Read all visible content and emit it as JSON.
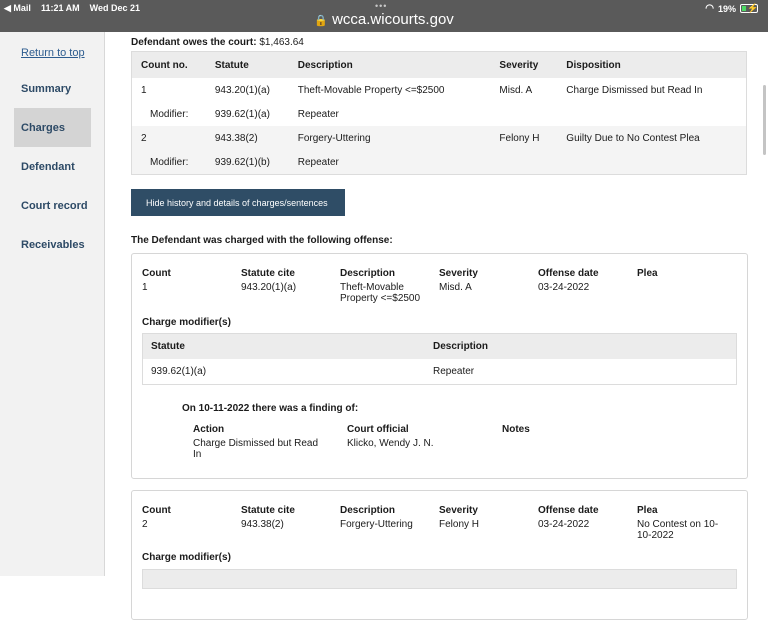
{
  "status_bar": {
    "back_app": "◀ Mail",
    "time": "11:21 AM",
    "date": "Wed Dec 21",
    "battery": "19%",
    "url": "wcca.wicourts.gov"
  },
  "sidebar": {
    "return_link": "Return to top",
    "items": [
      {
        "label": "Summary"
      },
      {
        "label": "Charges"
      },
      {
        "label": "Defendant"
      },
      {
        "label": "Court record"
      },
      {
        "label": "Receivables"
      }
    ]
  },
  "owes": {
    "label": "Defendant owes the court:",
    "amount": "$1,463.64"
  },
  "charges_table": {
    "headers": [
      "Count no.",
      "Statute",
      "Description",
      "Severity",
      "Disposition"
    ],
    "rows": [
      {
        "count": "1",
        "statute": "943.20(1)(a)",
        "description": "Theft-Movable Property <=$2500",
        "severity": "Misd. A",
        "disposition": "Charge Dismissed but Read In"
      },
      {
        "count": "Modifier:",
        "statute": "939.62(1)(a)",
        "description": "Repeater",
        "severity": "",
        "disposition": ""
      },
      {
        "count": "2",
        "statute": "943.38(2)",
        "description": "Forgery-Uttering",
        "severity": "Felony H",
        "disposition": "Guilty Due to No Contest Plea"
      },
      {
        "count": "Modifier:",
        "statute": "939.62(1)(b)",
        "description": "Repeater",
        "severity": "",
        "disposition": ""
      }
    ]
  },
  "history_button": "Hide history and details of charges/sentences",
  "offense_title": "The Defendant was charged with the following offense:",
  "offense_labels": {
    "count": "Count",
    "statute_cite": "Statute cite",
    "description": "Description",
    "severity": "Severity",
    "offense_date": "Offense date",
    "plea": "Plea",
    "charge_modifiers": "Charge modifier(s)",
    "mod_statute": "Statute",
    "mod_description": "Description",
    "action": "Action",
    "court_official": "Court official",
    "notes": "Notes"
  },
  "offenses": [
    {
      "count": "1",
      "statute_cite": "943.20(1)(a)",
      "description_l1": "Theft-Movable",
      "description_l2": "Property <=$2500",
      "severity": "Misd. A",
      "offense_date": "03-24-2022",
      "plea": "",
      "modifier_statute": "939.62(1)(a)",
      "modifier_description": "Repeater",
      "finding_title": "On 10-11-2022 there was a finding of:",
      "action_l1": "Charge Dismissed but Read",
      "action_l2": "In",
      "court_official": "Klicko, Wendy J. N.",
      "notes": ""
    },
    {
      "count": "2",
      "statute_cite": "943.38(2)",
      "description": "Forgery-Uttering",
      "severity": "Felony H",
      "offense_date": "03-24-2022",
      "plea_l1": "No Contest on 10-",
      "plea_l2": "10-2022"
    }
  ]
}
